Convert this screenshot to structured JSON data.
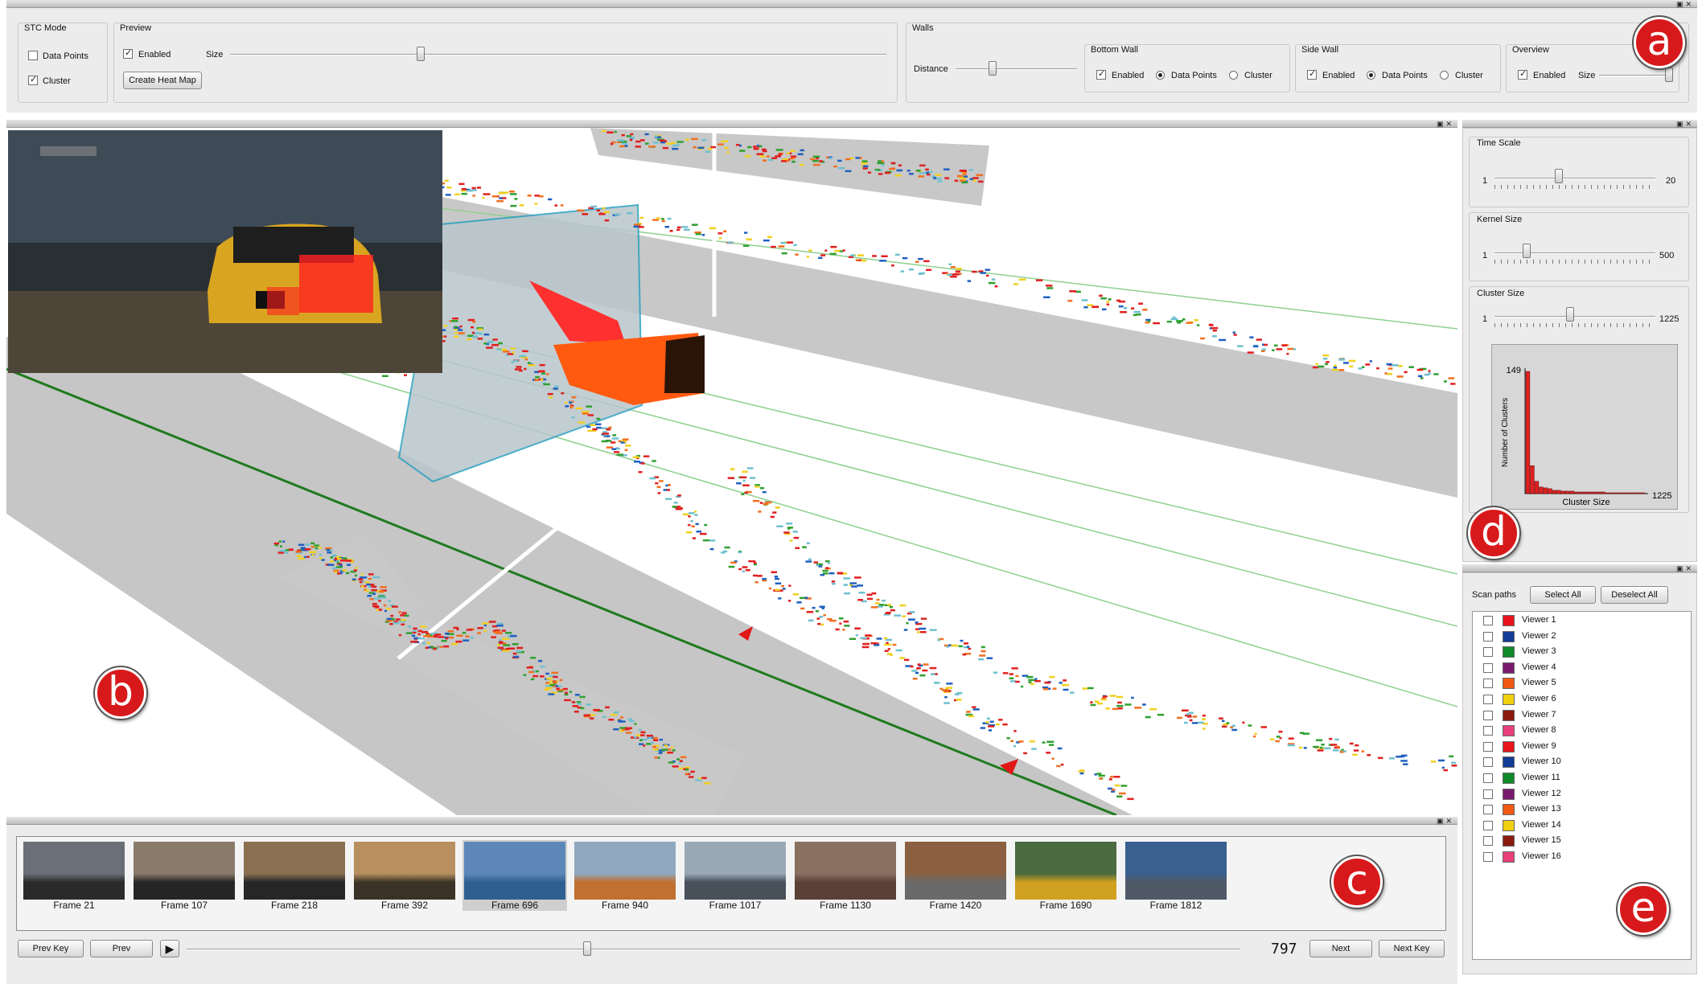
{
  "badges": {
    "a": "a",
    "b": "b",
    "c": "c",
    "d": "d",
    "e": "e"
  },
  "window": {
    "float_close_glyphs": "▣✕"
  },
  "toolbar": {
    "stc_mode": {
      "title": "STC Mode",
      "data_points": "Data Points",
      "data_points_checked": false,
      "cluster": "Cluster",
      "cluster_checked": true
    },
    "preview": {
      "title": "Preview",
      "enabled": "Enabled",
      "enabled_checked": true,
      "size": "Size",
      "size_value": 0.29,
      "create_heat_map": "Create Heat Map"
    },
    "walls": {
      "title": "Walls",
      "distance": "Distance",
      "distance_value": 0.3
    },
    "bottom_wall": {
      "title": "Bottom Wall",
      "enabled": "Enabled",
      "data_points": "Data Points",
      "cluster": "Cluster",
      "selected": "Data Points"
    },
    "side_wall": {
      "title": "Side Wall",
      "enabled": "Enabled",
      "data_points": "Data Points",
      "cluster": "Cluster",
      "selected": "Data Points"
    },
    "overview": {
      "title": "Overview",
      "enabled": "Enabled",
      "size": "Size",
      "size_value": 0.95
    }
  },
  "right_panel": {
    "time_scale": {
      "title": "Time Scale",
      "min": "1",
      "max": "20",
      "value": 0.4
    },
    "kernel_size": {
      "title": "Kernel Size",
      "min": "1",
      "max": "500",
      "value": 0.2
    },
    "cluster_size": {
      "title": "Cluster Size",
      "min": "1",
      "max": "1225",
      "value": 0.47
    },
    "histogram": {
      "y_max_label": "149",
      "y_label": "Number of Clusters",
      "x_label": "Cluster Size",
      "x_max_label": "1225",
      "color": "#e02020"
    }
  },
  "chart_data": {
    "type": "bar",
    "title": "",
    "xlabel": "Cluster Size",
    "ylabel": "Number of Clusters",
    "ylim": [
      0,
      149
    ],
    "xlim": [
      1,
      1225
    ],
    "values": [
      149,
      34,
      15,
      8,
      7,
      6,
      4,
      4,
      3,
      3,
      3,
      2,
      2,
      2,
      2,
      2,
      2,
      2,
      1,
      1,
      1,
      1,
      1,
      1,
      1,
      1,
      1
    ]
  },
  "scan_paths": {
    "title": "Scan paths",
    "select_all": "Select All",
    "deselect_all": "Deselect All",
    "viewers": [
      {
        "label": "Viewer 1",
        "color": "#e8141c"
      },
      {
        "label": "Viewer 2",
        "color": "#123c96"
      },
      {
        "label": "Viewer 3",
        "color": "#0f8a2a"
      },
      {
        "label": "Viewer 4",
        "color": "#7a1a6e"
      },
      {
        "label": "Viewer 5",
        "color": "#f05a14"
      },
      {
        "label": "Viewer 6",
        "color": "#f0d010"
      },
      {
        "label": "Viewer 7",
        "color": "#8a1a10"
      },
      {
        "label": "Viewer 8",
        "color": "#e8407a"
      },
      {
        "label": "Viewer 9",
        "color": "#e8141c"
      },
      {
        "label": "Viewer 10",
        "color": "#123c96"
      },
      {
        "label": "Viewer 11",
        "color": "#0f8a2a"
      },
      {
        "label": "Viewer 12",
        "color": "#7a1a6e"
      },
      {
        "label": "Viewer 13",
        "color": "#f05a14"
      },
      {
        "label": "Viewer 14",
        "color": "#f0d010"
      },
      {
        "label": "Viewer 15",
        "color": "#8a1a10"
      },
      {
        "label": "Viewer 16",
        "color": "#e8407a"
      }
    ]
  },
  "frames": [
    {
      "label": "Frame 21",
      "sky": "#6b6f78",
      "ground": "#2a2a2a"
    },
    {
      "label": "Frame 107",
      "sky": "#8a7a6a",
      "ground": "#252525"
    },
    {
      "label": "Frame 218",
      "sky": "#8a7050",
      "ground": "#262626"
    },
    {
      "label": "Frame 392",
      "sky": "#b89060",
      "ground": "#3a3226"
    },
    {
      "label": "Frame 696",
      "sky": "#5d87b8",
      "ground": "#2f5f90",
      "selected": true
    },
    {
      "label": "Frame 940",
      "sky": "#8fa8c0",
      "ground": "#c07030"
    },
    {
      "label": "Frame 1017",
      "sky": "#9aa8b6",
      "ground": "#48505a"
    },
    {
      "label": "Frame 1130",
      "sky": "#8a7060",
      "ground": "#5a4036"
    },
    {
      "label": "Frame 1420",
      "sky": "#8a6040",
      "ground": "#6a6a6a"
    },
    {
      "label": "Frame 1690",
      "sky": "#4a6a40",
      "ground": "#d0a020"
    },
    {
      "label": "Frame 1812",
      "sky": "#3a6090",
      "ground": "#505a66"
    }
  ],
  "timeline": {
    "prev_key": "Prev Key",
    "prev": "Prev",
    "play": "▶",
    "position": 0.38,
    "frame_number": "797",
    "next": "Next",
    "next_key": "Next Key"
  },
  "viewport": {
    "preview_heat_color": "#ff2020",
    "vehicle_color": "#ff5a10",
    "wall_color": "#c8c8c8"
  }
}
